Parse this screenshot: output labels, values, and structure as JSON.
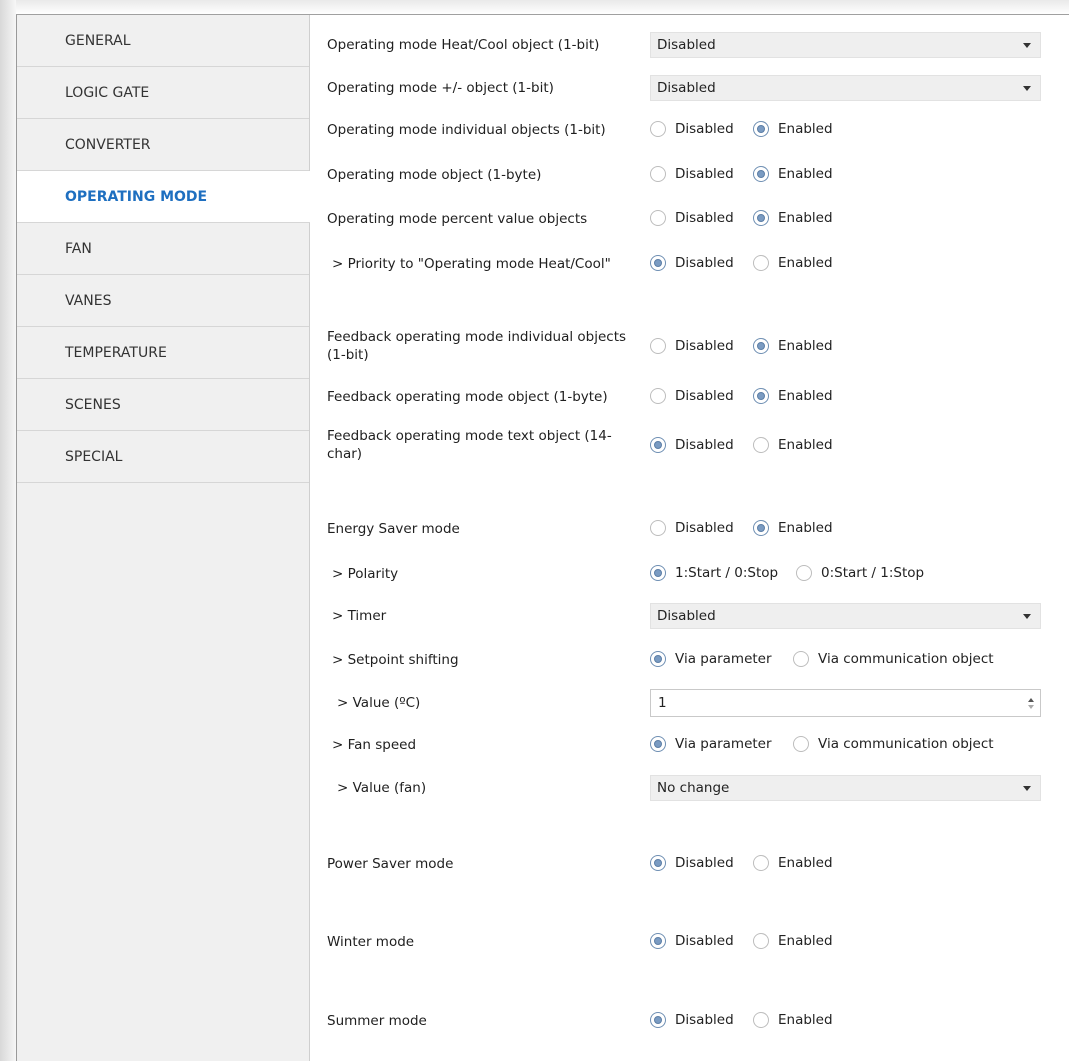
{
  "sidebar": {
    "items": [
      {
        "label": "GENERAL"
      },
      {
        "label": "LOGIC GATE"
      },
      {
        "label": "CONVERTER"
      },
      {
        "label": "OPERATING MODE"
      },
      {
        "label": "FAN"
      },
      {
        "label": "VANES"
      },
      {
        "label": "TEMPERATURE"
      },
      {
        "label": "SCENES"
      },
      {
        "label": "SPECIAL"
      }
    ],
    "active_index": 3
  },
  "params": {
    "heatcool_obj": {
      "label": "Operating mode Heat/Cool object (1-bit)",
      "value": "Disabled"
    },
    "plusminus_obj": {
      "label": "Operating mode +/- object (1-bit)",
      "value": "Disabled"
    },
    "individual_obj": {
      "label": "Operating mode individual objects (1-bit)",
      "opt1": "Disabled",
      "opt2": "Enabled",
      "selected": "Enabled"
    },
    "byte_obj": {
      "label": "Operating mode object (1-byte)",
      "opt1": "Disabled",
      "opt2": "Enabled",
      "selected": "Enabled"
    },
    "percent_obj": {
      "label": "Operating mode percent value objects",
      "opt1": "Disabled",
      "opt2": "Enabled",
      "selected": "Enabled"
    },
    "priority_heatcool": {
      "label": "> Priority to \"Operating mode Heat/Cool\"",
      "opt1": "Disabled",
      "opt2": "Enabled",
      "selected": "Disabled"
    },
    "fb_individual": {
      "label": "Feedback operating mode individual objects (1-bit)",
      "opt1": "Disabled",
      "opt2": "Enabled",
      "selected": "Enabled"
    },
    "fb_byte": {
      "label": "Feedback operating mode object (1-byte)",
      "opt1": "Disabled",
      "opt2": "Enabled",
      "selected": "Enabled"
    },
    "fb_text": {
      "label": "Feedback operating mode text object (14-char)",
      "opt1": "Disabled",
      "opt2": "Enabled",
      "selected": "Disabled"
    },
    "energy_saver": {
      "label": "Energy Saver mode",
      "opt1": "Disabled",
      "opt2": "Enabled",
      "selected": "Enabled"
    },
    "polarity": {
      "label": "> Polarity",
      "opt1": "1:Start / 0:Stop",
      "opt2": "0:Start / 1:Stop",
      "selected": "1:Start / 0:Stop"
    },
    "timer": {
      "label": "> Timer",
      "value": "Disabled"
    },
    "setpoint_shifting": {
      "label": "> Setpoint shifting",
      "opt1": "Via parameter",
      "opt2": "Via communication object",
      "selected": "Via parameter"
    },
    "value_c": {
      "label": "> Value (ºC)",
      "value": "1"
    },
    "fan_speed": {
      "label": "> Fan speed",
      "opt1": "Via parameter",
      "opt2": "Via communication object",
      "selected": "Via parameter"
    },
    "value_fan": {
      "label": "> Value (fan)",
      "value": "No change"
    },
    "power_saver": {
      "label": "Power Saver mode",
      "opt1": "Disabled",
      "opt2": "Enabled",
      "selected": "Disabled"
    },
    "winter": {
      "label": "Winter mode",
      "opt1": "Disabled",
      "opt2": "Enabled",
      "selected": "Disabled"
    },
    "summer": {
      "label": "Summer mode",
      "opt1": "Disabled",
      "opt2": "Enabled",
      "selected": "Disabled"
    }
  },
  "colors": {
    "active_nav": "#1e6fc0",
    "radio_selected": "#7a9bc2",
    "sidebar_bg": "#f0f0f0"
  }
}
